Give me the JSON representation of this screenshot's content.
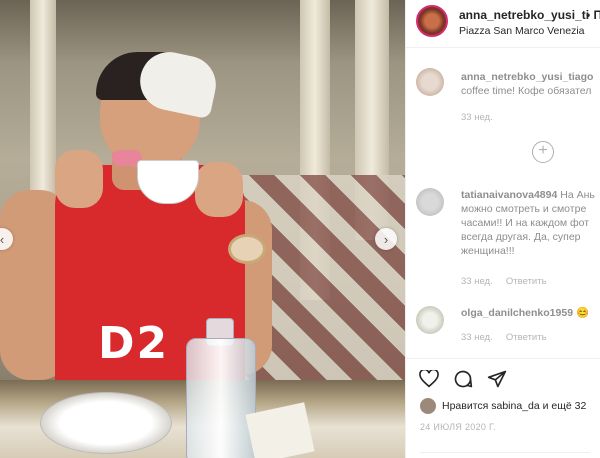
{
  "post": {
    "username": "anna_netrebko_yusi_ti",
    "follow_separator": "• Под",
    "location": "Piazza San Marco Venezia",
    "photo": {
      "shirt_print": "D2"
    }
  },
  "comments": [
    {
      "user": "anna_netrebko_yusi_tiago",
      "text_lines": [
        "coffee time! Кофе обязател"
      ],
      "meta": "33 нед.",
      "avatar_color": "#d8c9bd"
    },
    {
      "user": "tatianaivanova4894",
      "text_lines": [
        "На Ань",
        "можно смотреть и смотре",
        "часами!! И на каждом фот",
        "всегда другая. Да, супер",
        "женщина!!!"
      ],
      "meta": "33 нед.",
      "reply_label": "Ответить",
      "avatar_color": "#c7c7c7"
    },
    {
      "user": "olga_danilchenko1959",
      "text_lines": [
        "😊"
      ],
      "meta": "33 нед.",
      "reply_label": "Ответить",
      "avatar_color": "#c2c7b8"
    }
  ],
  "load_more_icon": "plus-circle-icon",
  "actions": {
    "like_icon": "heart-icon",
    "comment_icon": "comment-icon",
    "share_icon": "share-icon"
  },
  "likes": {
    "text": "Нравится sabina_da и ещё 32"
  },
  "date": "24 ИЮЛЯ 2020 Г."
}
